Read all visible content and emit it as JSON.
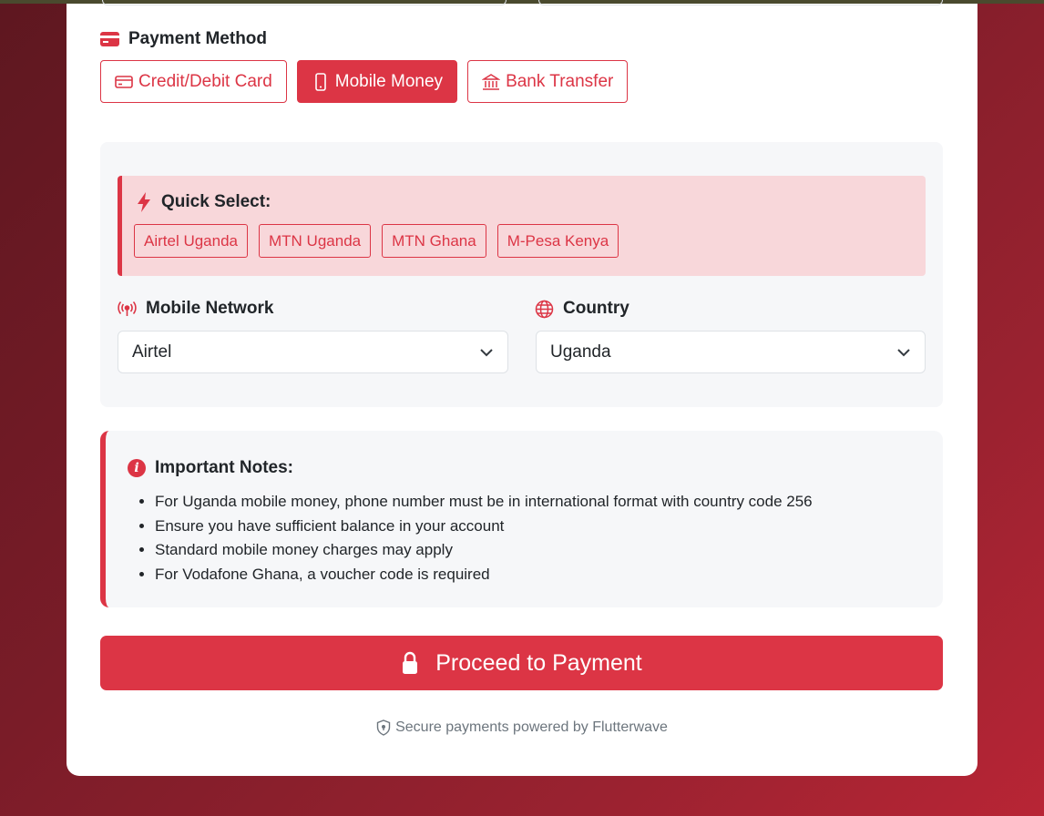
{
  "payment_method": {
    "title": "Payment Method",
    "options": [
      {
        "label": "Credit/Debit Card",
        "icon": "credit-card-icon",
        "active": false
      },
      {
        "label": "Mobile Money",
        "icon": "phone-icon",
        "active": true
      },
      {
        "label": "Bank Transfer",
        "icon": "bank-icon",
        "active": false
      }
    ]
  },
  "quick_select": {
    "title": "Quick Select:",
    "chips": [
      "Airtel Uganda",
      "MTN Uganda",
      "MTN Ghana",
      "M-Pesa Kenya"
    ]
  },
  "network": {
    "label": "Mobile Network",
    "value": "Airtel"
  },
  "country": {
    "label": "Country",
    "value": "Uganda"
  },
  "notes": {
    "title": "Important Notes:",
    "items": [
      "For Uganda mobile money, phone number must be in international format with country code 256",
      "Ensure you have sufficient balance in your account",
      "Standard mobile money charges may apply",
      "For Vodafone Ghana, a voucher code is required"
    ]
  },
  "proceed_label": "Proceed to Payment",
  "footer_text": "Secure payments powered by Flutterwave",
  "colors": {
    "accent": "#dc3545",
    "panel": "#f6f7f9",
    "quick_bg": "#f8d7da"
  }
}
